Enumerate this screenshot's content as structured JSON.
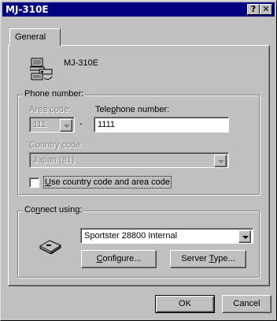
{
  "window": {
    "title": "MJ-310E",
    "help_btn": "?",
    "close_btn": "✕"
  },
  "tabs": [
    {
      "label": "General"
    }
  ],
  "device": {
    "name": "MJ-310E"
  },
  "phone": {
    "group_title": "Phone number:",
    "area_code_label": "Area code:",
    "area_code_value": "111",
    "dash": "-",
    "telephone_label": "Telephone number:",
    "telephone_value": "1111",
    "country_code_label": "Country code:",
    "country_code_value": "Japan (81)",
    "use_country_code_label": "Use country code and area code",
    "use_country_code_checked": false
  },
  "connect": {
    "group_title": "Connect using:",
    "modem_value": "Sportster 28800 Internal",
    "configure_label": "Configure...",
    "server_type_label": "Server Type..."
  },
  "footer": {
    "ok_label": "OK",
    "cancel_label": "Cancel"
  },
  "colors": {
    "titlebar": "#000080",
    "face": "#c0c0c0"
  }
}
